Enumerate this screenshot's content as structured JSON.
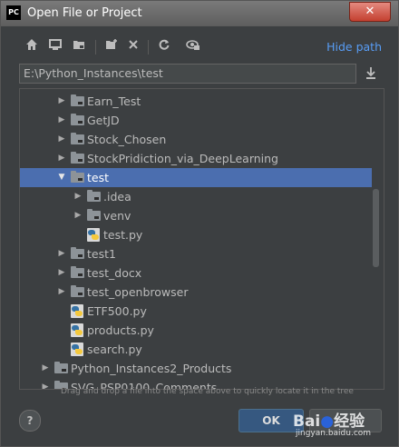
{
  "window": {
    "title": "Open File or Project",
    "logo_text": "PC",
    "close_glyph": "✕"
  },
  "toolbar": {
    "icons": [
      "home-icon",
      "desktop-icon",
      "project-folder-icon",
      "new-folder-icon",
      "delete-icon",
      "refresh-icon",
      "show-hidden-icon"
    ],
    "hide_path_label": "Hide path"
  },
  "path": {
    "value": "E:\\Python_Instances\\test"
  },
  "tree": {
    "rows": [
      {
        "label": "Earn_Test",
        "type": "folder",
        "level": 1,
        "expanded": false,
        "selected": false
      },
      {
        "label": "GetJD",
        "type": "folder",
        "level": 1,
        "expanded": false,
        "selected": false
      },
      {
        "label": "Stock_Chosen",
        "type": "folder",
        "level": 1,
        "expanded": false,
        "selected": false
      },
      {
        "label": "StockPridiction_via_DeepLearning",
        "type": "folder",
        "level": 1,
        "expanded": false,
        "selected": false
      },
      {
        "label": "test",
        "type": "folder",
        "level": 1,
        "expanded": true,
        "selected": true
      },
      {
        "label": ".idea",
        "type": "folder",
        "level": 2,
        "expanded": false,
        "selected": false
      },
      {
        "label": "venv",
        "type": "folder",
        "level": 2,
        "expanded": false,
        "selected": false
      },
      {
        "label": "test.py",
        "type": "python-file",
        "level": 2,
        "selected": false
      },
      {
        "label": "test1",
        "type": "folder",
        "level": 1,
        "expanded": false,
        "selected": false
      },
      {
        "label": "test_docx",
        "type": "folder",
        "level": 1,
        "expanded": false,
        "selected": false
      },
      {
        "label": "test_openbrowser",
        "type": "folder",
        "level": 1,
        "expanded": false,
        "selected": false
      },
      {
        "label": "ETF500.py",
        "type": "python-file",
        "level": 1,
        "selected": false
      },
      {
        "label": "products.py",
        "type": "python-file",
        "level": 1,
        "selected": false
      },
      {
        "label": "search.py",
        "type": "python-file",
        "level": 1,
        "selected": false
      },
      {
        "label": "Python_Instances2_Products",
        "type": "folder",
        "level": 0,
        "expanded": false,
        "selected": false
      },
      {
        "label": "SVG_PSP0100_Comments",
        "type": "folder",
        "level": 0,
        "expanded": false,
        "selected": false
      }
    ]
  },
  "hint": "Drag and drop a file into the space above to quickly locate it in the tree",
  "footer": {
    "help_label": "?",
    "ok_label": "OK",
    "cancel_label": ""
  },
  "watermark": {
    "brand_left": "Bai",
    "brand_right": "经验",
    "url": "jingyan.baidu.com"
  }
}
